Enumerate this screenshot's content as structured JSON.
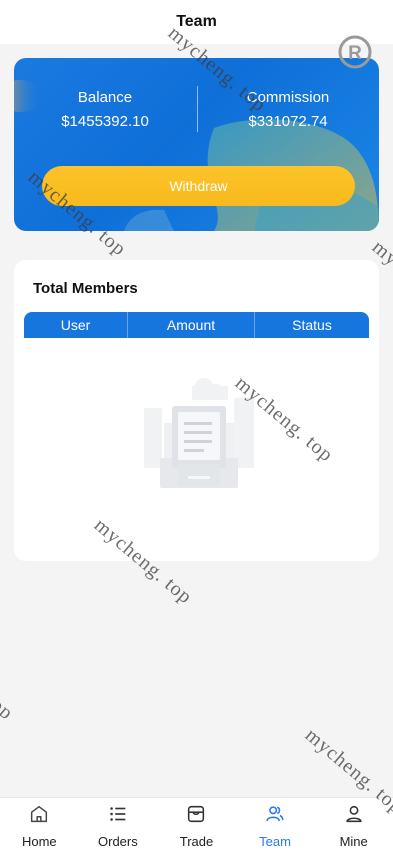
{
  "header": {
    "title": "Team"
  },
  "balance_card": {
    "balance_label": "Balance",
    "balance_value": "$1455392.10",
    "commission_label": "Commission",
    "commission_value": "$331072.74",
    "withdraw_label": "Withdraw"
  },
  "members": {
    "title": "Total Members",
    "columns": [
      "User",
      "Amount",
      "Status"
    ]
  },
  "watermark": {
    "text": "mycheng. top"
  },
  "tabbar": {
    "items": [
      {
        "label": "Home",
        "icon": "home-icon"
      },
      {
        "label": "Orders",
        "icon": "list-icon"
      },
      {
        "label": "Trade",
        "icon": "store-icon"
      },
      {
        "label": "Team",
        "icon": "team-icon",
        "active": true
      },
      {
        "label": "Mine",
        "icon": "user-icon"
      }
    ]
  },
  "colors": {
    "primary_blue": "#1676de",
    "button_yellow": "#fbbf24",
    "active_tab": "#2a7be4",
    "background": "#f4f4f4"
  }
}
